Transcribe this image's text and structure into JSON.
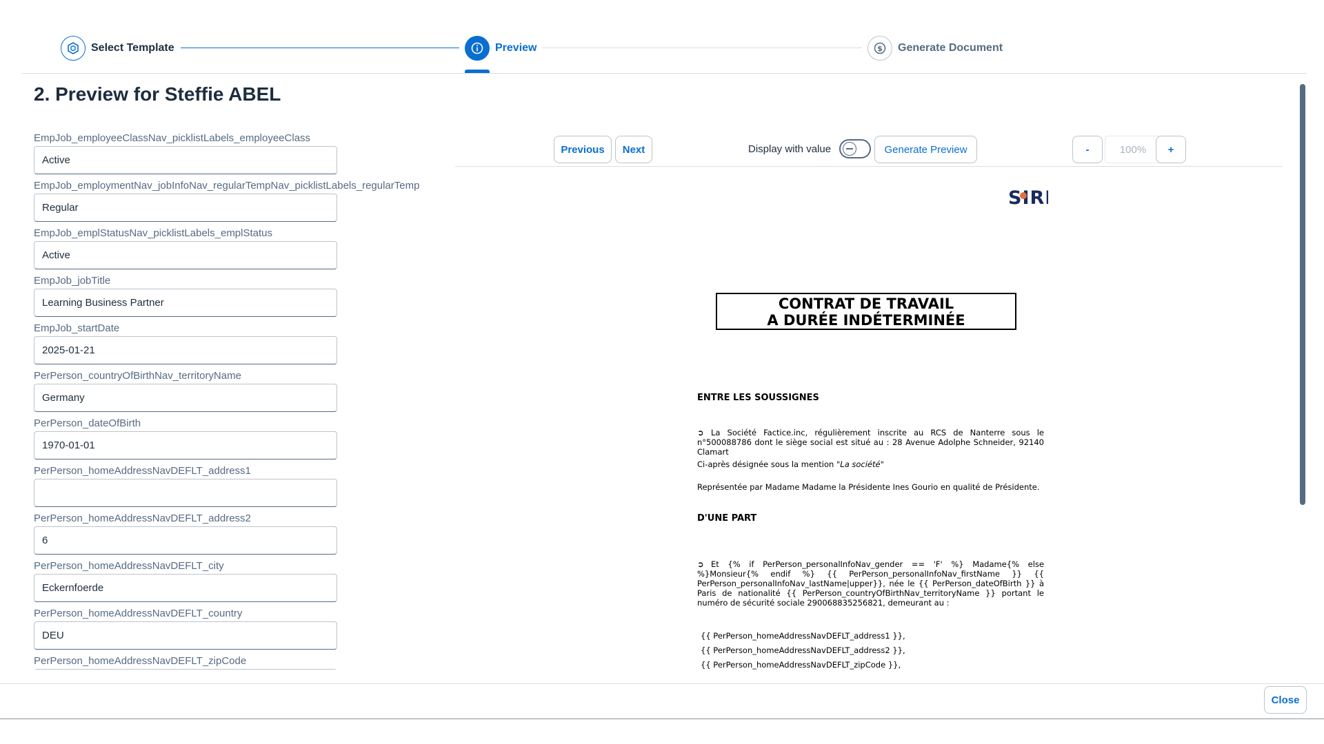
{
  "wizard": {
    "steps": [
      {
        "label": "Select Template",
        "icon": "template-icon",
        "state": "completed"
      },
      {
        "label": "Preview",
        "icon": "info-icon",
        "state": "active"
      },
      {
        "label": "Generate Document",
        "icon": "dollar-icon",
        "state": "pending"
      }
    ]
  },
  "page_title": "2. Preview for Steffie ABEL",
  "fields": [
    {
      "label": "EmpJob_employeeClassNav_picklistLabels_employeeClass",
      "value": "Active"
    },
    {
      "label": "EmpJob_employmentNav_jobInfoNav_regularTempNav_picklistLabels_regularTemp",
      "value": "Regular"
    },
    {
      "label": "EmpJob_emplStatusNav_picklistLabels_emplStatus",
      "value": "Active"
    },
    {
      "label": "EmpJob_jobTitle",
      "value": "Learning Business Partner"
    },
    {
      "label": "EmpJob_startDate",
      "value": "2025-01-21"
    },
    {
      "label": "PerPerson_countryOfBirthNav_territoryName",
      "value": "Germany"
    },
    {
      "label": "PerPerson_dateOfBirth",
      "value": "1970-01-01"
    },
    {
      "label": "PerPerson_homeAddressNavDEFLT_address1",
      "value": ""
    },
    {
      "label": "PerPerson_homeAddressNavDEFLT_address2",
      "value": "6"
    },
    {
      "label": "PerPerson_homeAddressNavDEFLT_city",
      "value": "Eckernfoerde"
    },
    {
      "label": "PerPerson_homeAddressNavDEFLT_country",
      "value": "DEU"
    },
    {
      "label": "PerPerson_homeAddressNavDEFLT_zipCode",
      "value": ""
    }
  ],
  "toolbar": {
    "previous_label": "Previous",
    "next_label": "Next",
    "display_with_value_label": "Display with value",
    "display_with_value_on": false,
    "generate_preview_label": "Generate Preview",
    "zoom_out_label": "-",
    "zoom_level": "100%",
    "zoom_in_label": "+"
  },
  "document": {
    "logo_text": "SIRH",
    "title_line1": "CONTRAT DE TRAVAIL",
    "title_line2": "A DURÉE INDÉTERMINÉE",
    "heading_between": "ENTRE LES SOUSSIGNES",
    "arrow_glyph": "➲",
    "company_para": "La Société Factice.inc, régulièrement inscrite au RCS de Nanterre sous le n°500088786 dont le siège social est situé au : 28 Avenue Adolphe Schneider, 92140 Clamart",
    "designation_prefix": "Ci-après désignée sous la mention \"",
    "designation_italic": "La société",
    "designation_suffix": "\"",
    "represented_para": "Représentée par Madame Madame la Présidente Ines Gourio en qualité de Présidente.",
    "heading_part": "D'UNE PART",
    "employee_para": "Et {% if PerPerson_personalInfoNav_gender == 'F' %} Madame{% else %}Monsieur{% endif %} {{ PerPerson_personalInfoNav_firstName }} {{ PerPerson_personalInfoNav_lastName|upper}}, née le {{ PerPerson_dateOfBirth }} à Paris de nationalité {{ PerPerson_countryOfBirthNav_territoryName }} portant le numéro de sécurité sociale 290068835256821, demeurant au :",
    "var_lines": [
      "{{ PerPerson_homeAddressNavDEFLT_address1 }},",
      "{{ PerPerson_homeAddressNavDEFLT_address2 }},",
      "{{ PerPerson_homeAddressNavDEFLT_zipCode }},"
    ]
  },
  "footer": {
    "close_label": "Close"
  },
  "colors": {
    "accent": "#0a6ed1",
    "text": "#1d2d3e",
    "label": "#556b82",
    "border": "#bcc3ca",
    "logo_dot": "#e8703a"
  }
}
